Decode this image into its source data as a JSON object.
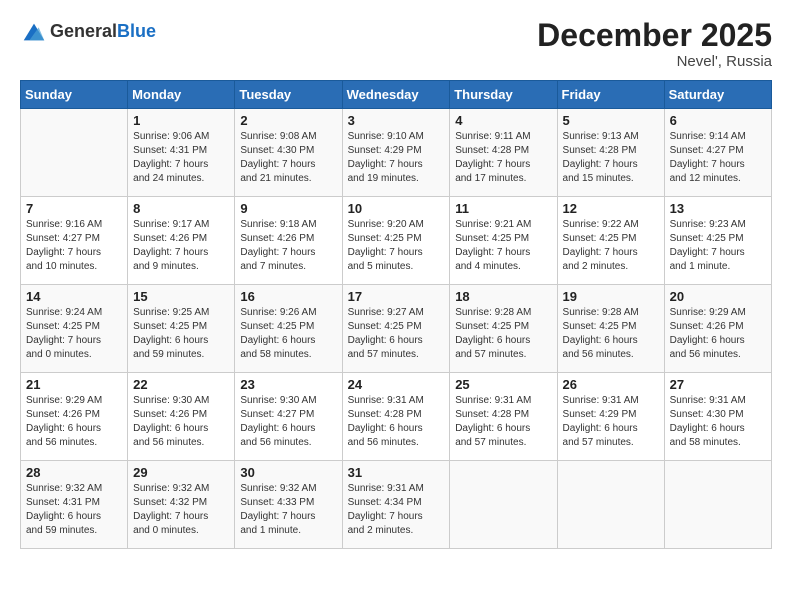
{
  "header": {
    "logo_line1": "General",
    "logo_line2": "Blue",
    "month": "December 2025",
    "location": "Nevel', Russia"
  },
  "weekdays": [
    "Sunday",
    "Monday",
    "Tuesday",
    "Wednesday",
    "Thursday",
    "Friday",
    "Saturday"
  ],
  "weeks": [
    [
      {
        "day": "",
        "info": ""
      },
      {
        "day": "1",
        "info": "Sunrise: 9:06 AM\nSunset: 4:31 PM\nDaylight: 7 hours\nand 24 minutes."
      },
      {
        "day": "2",
        "info": "Sunrise: 9:08 AM\nSunset: 4:30 PM\nDaylight: 7 hours\nand 21 minutes."
      },
      {
        "day": "3",
        "info": "Sunrise: 9:10 AM\nSunset: 4:29 PM\nDaylight: 7 hours\nand 19 minutes."
      },
      {
        "day": "4",
        "info": "Sunrise: 9:11 AM\nSunset: 4:28 PM\nDaylight: 7 hours\nand 17 minutes."
      },
      {
        "day": "5",
        "info": "Sunrise: 9:13 AM\nSunset: 4:28 PM\nDaylight: 7 hours\nand 15 minutes."
      },
      {
        "day": "6",
        "info": "Sunrise: 9:14 AM\nSunset: 4:27 PM\nDaylight: 7 hours\nand 12 minutes."
      }
    ],
    [
      {
        "day": "7",
        "info": "Sunrise: 9:16 AM\nSunset: 4:27 PM\nDaylight: 7 hours\nand 10 minutes."
      },
      {
        "day": "8",
        "info": "Sunrise: 9:17 AM\nSunset: 4:26 PM\nDaylight: 7 hours\nand 9 minutes."
      },
      {
        "day": "9",
        "info": "Sunrise: 9:18 AM\nSunset: 4:26 PM\nDaylight: 7 hours\nand 7 minutes."
      },
      {
        "day": "10",
        "info": "Sunrise: 9:20 AM\nSunset: 4:25 PM\nDaylight: 7 hours\nand 5 minutes."
      },
      {
        "day": "11",
        "info": "Sunrise: 9:21 AM\nSunset: 4:25 PM\nDaylight: 7 hours\nand 4 minutes."
      },
      {
        "day": "12",
        "info": "Sunrise: 9:22 AM\nSunset: 4:25 PM\nDaylight: 7 hours\nand 2 minutes."
      },
      {
        "day": "13",
        "info": "Sunrise: 9:23 AM\nSunset: 4:25 PM\nDaylight: 7 hours\nand 1 minute."
      }
    ],
    [
      {
        "day": "14",
        "info": "Sunrise: 9:24 AM\nSunset: 4:25 PM\nDaylight: 7 hours\nand 0 minutes."
      },
      {
        "day": "15",
        "info": "Sunrise: 9:25 AM\nSunset: 4:25 PM\nDaylight: 6 hours\nand 59 minutes."
      },
      {
        "day": "16",
        "info": "Sunrise: 9:26 AM\nSunset: 4:25 PM\nDaylight: 6 hours\nand 58 minutes."
      },
      {
        "day": "17",
        "info": "Sunrise: 9:27 AM\nSunset: 4:25 PM\nDaylight: 6 hours\nand 57 minutes."
      },
      {
        "day": "18",
        "info": "Sunrise: 9:28 AM\nSunset: 4:25 PM\nDaylight: 6 hours\nand 57 minutes."
      },
      {
        "day": "19",
        "info": "Sunrise: 9:28 AM\nSunset: 4:25 PM\nDaylight: 6 hours\nand 56 minutes."
      },
      {
        "day": "20",
        "info": "Sunrise: 9:29 AM\nSunset: 4:26 PM\nDaylight: 6 hours\nand 56 minutes."
      }
    ],
    [
      {
        "day": "21",
        "info": "Sunrise: 9:29 AM\nSunset: 4:26 PM\nDaylight: 6 hours\nand 56 minutes."
      },
      {
        "day": "22",
        "info": "Sunrise: 9:30 AM\nSunset: 4:26 PM\nDaylight: 6 hours\nand 56 minutes."
      },
      {
        "day": "23",
        "info": "Sunrise: 9:30 AM\nSunset: 4:27 PM\nDaylight: 6 hours\nand 56 minutes."
      },
      {
        "day": "24",
        "info": "Sunrise: 9:31 AM\nSunset: 4:28 PM\nDaylight: 6 hours\nand 56 minutes."
      },
      {
        "day": "25",
        "info": "Sunrise: 9:31 AM\nSunset: 4:28 PM\nDaylight: 6 hours\nand 57 minutes."
      },
      {
        "day": "26",
        "info": "Sunrise: 9:31 AM\nSunset: 4:29 PM\nDaylight: 6 hours\nand 57 minutes."
      },
      {
        "day": "27",
        "info": "Sunrise: 9:31 AM\nSunset: 4:30 PM\nDaylight: 6 hours\nand 58 minutes."
      }
    ],
    [
      {
        "day": "28",
        "info": "Sunrise: 9:32 AM\nSunset: 4:31 PM\nDaylight: 6 hours\nand 59 minutes."
      },
      {
        "day": "29",
        "info": "Sunrise: 9:32 AM\nSunset: 4:32 PM\nDaylight: 7 hours\nand 0 minutes."
      },
      {
        "day": "30",
        "info": "Sunrise: 9:32 AM\nSunset: 4:33 PM\nDaylight: 7 hours\nand 1 minute."
      },
      {
        "day": "31",
        "info": "Sunrise: 9:31 AM\nSunset: 4:34 PM\nDaylight: 7 hours\nand 2 minutes."
      },
      {
        "day": "",
        "info": ""
      },
      {
        "day": "",
        "info": ""
      },
      {
        "day": "",
        "info": ""
      }
    ]
  ]
}
